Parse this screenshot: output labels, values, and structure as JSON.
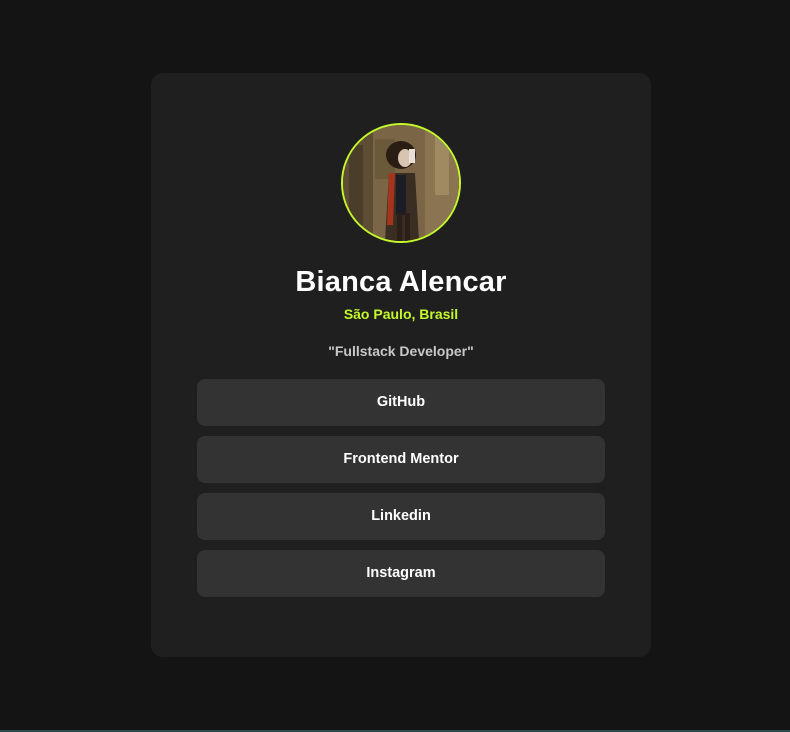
{
  "profile": {
    "name": "Bianca Alencar",
    "location": "São Paulo, Brasil",
    "bio": "\"Fullstack Developer\""
  },
  "links": [
    {
      "label": "GitHub"
    },
    {
      "label": "Frontend Mentor"
    },
    {
      "label": "Linkedin"
    },
    {
      "label": "Instagram"
    }
  ],
  "colors": {
    "page_background": "#141414",
    "card_background": "#1f1f1f",
    "accent": "#c4f82a",
    "button_background": "#333333",
    "text_primary": "#ffffff",
    "text_secondary": "#c8c8c8"
  }
}
